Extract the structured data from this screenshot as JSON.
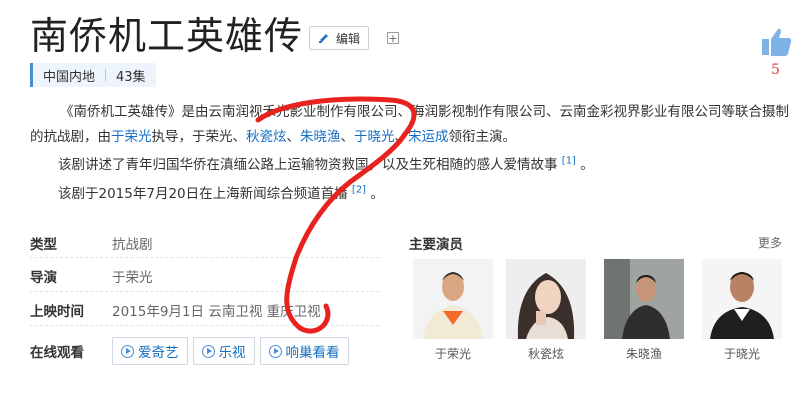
{
  "title": "南侨机工英雄传",
  "edit_label": "编辑",
  "plus_label": "+",
  "tags": [
    "中国内地",
    "43集"
  ],
  "like_count": "5",
  "summary": {
    "p1_a": "《南侨机工英雄传》是由云南润视禾光影业制作有限公司、海润影视制作有限公司、云南金彩视界影业有限公司等联合摄制",
    "p2_a": "的抗战剧，由",
    "p2_director": "于荣光",
    "p2_b": "执导，于荣光、",
    "p2_cast1": "秋瓷炫",
    "p2_sep1": "、",
    "p2_cast2": "朱晓渔",
    "p2_sep2": "、",
    "p2_cast3": "于晓光",
    "p2_sep3": "、",
    "p2_cast4": "宋运成",
    "p2_c": "领衔主演。",
    "p3": "该剧讲述了青年归国华侨在滇缅公路上运输物资救国，以及生死相随的感人爱情故事",
    "p3_ref": "[1]",
    "p3_end": " 。",
    "p4": "该剧于2015年7月20日在上海新闻综合频道首播",
    "p4_ref": "[2]",
    "p4_end": " 。"
  },
  "info": {
    "type_label": "类型",
    "type_value": "抗战剧",
    "director_label": "导演",
    "director_value": "于荣光",
    "release_label": "上映时间",
    "release_value": "2015年9月1日 云南卫视 重庆卫视",
    "watch_label": "在线观看",
    "watch_options": [
      "爱奇艺",
      "乐视",
      "响巢看看"
    ]
  },
  "cast_section": {
    "heading": "主要演员",
    "more": "更多",
    "members": [
      "于荣光",
      "秋瓷炫",
      "朱晓渔",
      "于晓光"
    ]
  },
  "colors": {
    "link": "#136ec2",
    "annotation": "#e8231f",
    "like_icon": "#7fb3e6"
  }
}
